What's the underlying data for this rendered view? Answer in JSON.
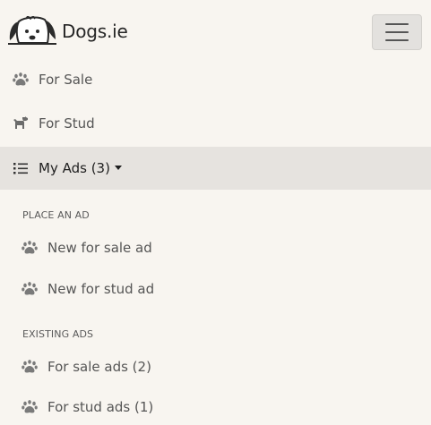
{
  "brand": {
    "name": "Dogs.ie"
  },
  "nav": {
    "for_sale": "For Sale",
    "for_stud": "For Stud",
    "my_ads": "My Ads (3)"
  },
  "dropdown": {
    "place_header": "PLACE AN AD",
    "place_items": [
      "New for sale ad",
      "New for stud ad"
    ],
    "existing_header": "EXISTING ADS",
    "existing_items": [
      "For sale ads (2)",
      "For stud ads (1)"
    ]
  },
  "colors": {
    "background": "#f8f5f0",
    "active_bg": "#e6e3df",
    "icon": "#6b6b6b",
    "text": "#555555"
  },
  "icons": {
    "logo": "dog-face-logo",
    "toggler": "hamburger-icon",
    "for_sale": "paw-icon",
    "for_stud": "dog-icon",
    "my_ads": "list-icon",
    "sub_items": "paw-icon"
  }
}
